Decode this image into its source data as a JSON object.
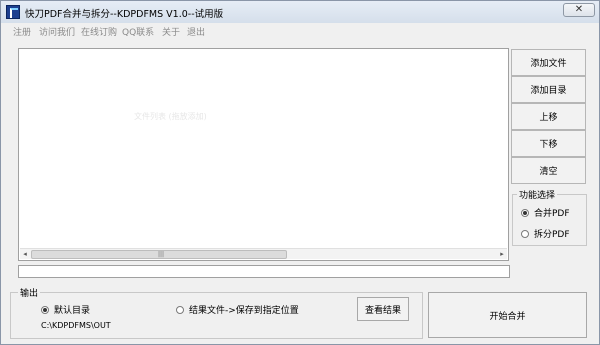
{
  "window": {
    "title": "快刀PDF合并与拆分--KDPDFMS V1.0--试用版",
    "close_glyph": "✕"
  },
  "menu": [
    "注册",
    "访问我们",
    "在线订购",
    "QQ联系",
    "关于",
    "退出"
  ],
  "file_list": {
    "placeholder": "文件列表 (拖放添加)",
    "scroll_left": "◂",
    "scroll_right": "▸",
    "grip": "|||"
  },
  "side_buttons": [
    "添加文件",
    "添加目录",
    "上移",
    "下移",
    "清空"
  ],
  "function_group": {
    "label": "功能选择",
    "options": [
      "合并PDF",
      "拆分PDF"
    ],
    "selected": "合并PDF"
  },
  "output_group": {
    "label": "输出",
    "default_dir_label": "默认目录",
    "custom_label": "结果文件->保存到指定位置",
    "selected": "默认目录",
    "path": "C:\\KDPDFMS\\OUT",
    "view_button": "查看结果"
  },
  "start_button": "开始合并"
}
